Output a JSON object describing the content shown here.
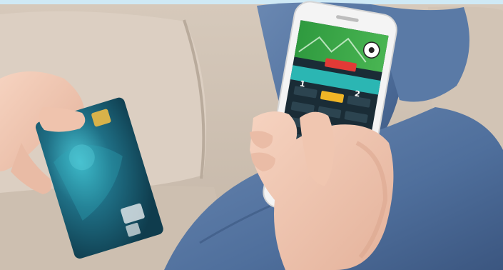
{
  "scene": {
    "subject": "hand-holding-credit-card-and-smartphone-with-betting-app",
    "colors": {
      "frame": "#cfe9f5",
      "sofa": "#d8cbbd",
      "sofa_shadow": "#bcae9f",
      "jeans": "#4f6f9c",
      "jeans_dark": "#3b5680",
      "skin": "#f1c9b3",
      "skin_shadow": "#e0ab94",
      "card": "#17566b",
      "card_glow": "#3fb7c8",
      "chip": "#d7b24a",
      "phone_body": "#f4f4f4",
      "app_field": "#3ea64a",
      "app_bg": "#1a2c36",
      "app_teal": "#2bb6b3",
      "app_red": "#e23a36",
      "app_gold": "#f0b526"
    }
  },
  "phone_screen": {
    "score_home": "1",
    "score_away": "2"
  }
}
